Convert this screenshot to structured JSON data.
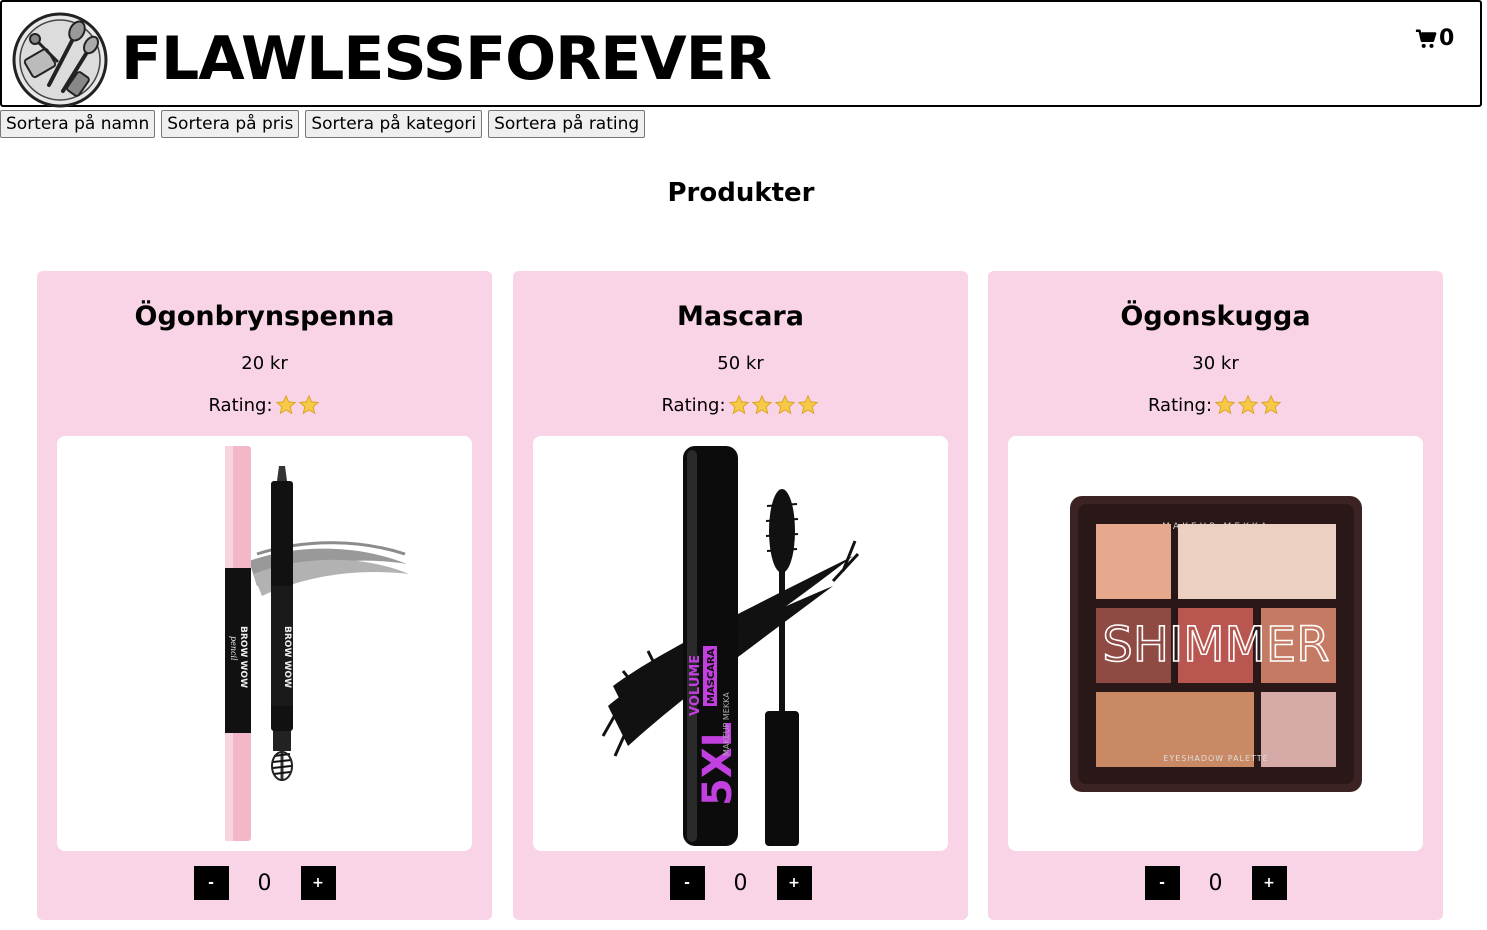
{
  "header": {
    "brand": "FLAWLESSFOREVER",
    "logo_icon": "makeup-brushes-icon",
    "cart_icon": "shopping-cart-icon",
    "cart_count": "0"
  },
  "sort_buttons": {
    "name": "Sortera på namn",
    "price": "Sortera på pris",
    "category": "Sortera på kategori",
    "rating": "Sortera på rating"
  },
  "products_heading": "Produkter",
  "products": [
    {
      "name": "Ögonbrynspenna",
      "price": "20 kr",
      "rating_label": "Rating:",
      "rating": 2,
      "image_icon": "brow-pencil-image",
      "image_text": [
        "BROW WOW",
        "pencil"
      ],
      "qty": "0",
      "minus": "-",
      "plus": "+"
    },
    {
      "name": "Mascara",
      "price": "50 kr",
      "rating_label": "Rating:",
      "rating": 4,
      "image_icon": "mascara-image",
      "image_text": [
        "5XL",
        "VOLUME",
        "MASCARA",
        "MAKEUP MEKKA"
      ],
      "qty": "0",
      "minus": "-",
      "plus": "+"
    },
    {
      "name": "Ögonskugga",
      "price": "30 kr",
      "rating_label": "Rating:",
      "rating": 3,
      "image_icon": "eyeshadow-palette-image",
      "image_text": [
        "MAKEUP MEKKA",
        "SHIMMER",
        "EYESHADOW PALETTE"
      ],
      "qty": "0",
      "minus": "-",
      "plus": "+"
    }
  ],
  "colors": {
    "card_bg": "#f9d3e6",
    "star": "#f7c948",
    "button_bg": "#000000"
  }
}
